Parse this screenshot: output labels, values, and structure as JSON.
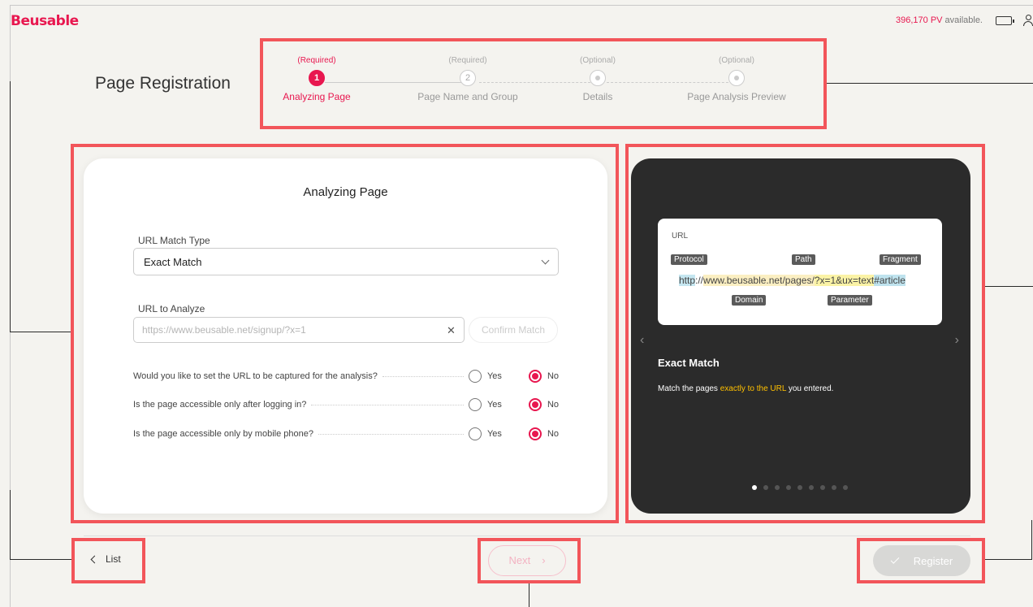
{
  "header": {
    "logo": "Beusable",
    "pv_count": "396,170 PV",
    "pv_suffix": "available."
  },
  "page": {
    "title": "Page Registration"
  },
  "stepper": {
    "steps": [
      {
        "requirement": "(Required)",
        "number": "1",
        "label": "Analyzing Page",
        "active": true
      },
      {
        "requirement": "(Required)",
        "number": "2",
        "label": "Page Name and Group",
        "active": false
      },
      {
        "requirement": "(Optional)",
        "number": "",
        "label": "Details",
        "active": false
      },
      {
        "requirement": "(Optional)",
        "number": "",
        "label": "Page Analysis Preview",
        "active": false
      }
    ]
  },
  "form": {
    "title": "Analyzing Page",
    "url_match_type_label": "URL Match Type",
    "url_match_type_value": "Exact Match",
    "url_to_analyze_label": "URL to Analyze",
    "url_placeholder": "https://www.beusable.net/signup/?x=1",
    "url_value": "",
    "confirm_match": "Confirm Match",
    "questions": [
      {
        "text": "Would you like to set the URL to be captured for the analysis?",
        "yes": "Yes",
        "no": "No",
        "selected": "No"
      },
      {
        "text": "Is the page accessible only after logging in?",
        "yes": "Yes",
        "no": "No",
        "selected": "No"
      },
      {
        "text": "Is the page accessible only by mobile phone?",
        "yes": "Yes",
        "no": "No",
        "selected": "No"
      }
    ]
  },
  "preview": {
    "box_label": "URL",
    "tags": {
      "protocol": "Protocol",
      "path": "Path",
      "fragment": "Fragment",
      "domain": "Domain",
      "parameter": "Parameter"
    },
    "url_parts": {
      "protocol": "http",
      "sep": "://",
      "domain": "www.beusable.net",
      "path": "/pages/",
      "param": "?x=1&ux=text",
      "fragment": "#article"
    },
    "title": "Exact Match",
    "desc_before": "Match the pages ",
    "desc_highlight": "exactly to the URL",
    "desc_after": " you entered.",
    "page_count": 9,
    "active_page": 1
  },
  "footer": {
    "list": "List",
    "next": "Next",
    "register": "Register"
  },
  "colors": {
    "brand": "#e8174f",
    "highlight_box": "#f2555a",
    "preview_bg": "#2b2b2b"
  }
}
